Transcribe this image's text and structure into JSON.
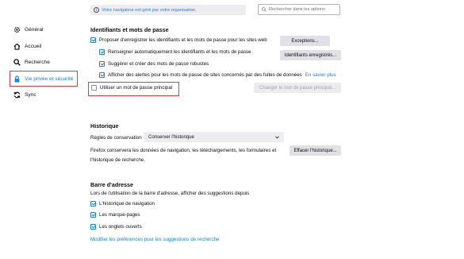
{
  "banner": {
    "text": "Votre navigateur est géré par votre organisation.",
    "icon": "info-icon"
  },
  "search": {
    "placeholder": "Rechercher dans les options",
    "icon": "search-icon"
  },
  "sidebar": {
    "items": [
      {
        "label": "Général",
        "icon": "gear-icon"
      },
      {
        "label": "Accueil",
        "icon": "home-icon"
      },
      {
        "label": "Recherche",
        "icon": "search-icon"
      },
      {
        "label": "Vie privée et sécurité",
        "icon": "lock-icon",
        "selected": true
      },
      {
        "label": "Sync",
        "icon": "sync-icon"
      }
    ]
  },
  "logins": {
    "title": "Identifiants et mots de passe",
    "ask_save": "Proposer d'enregistrer les identifiants et les mots de passe pour les sites web",
    "autofill": "Renseigner automatiquement les identifiants et les mots de passe",
    "suggest": "Suggérer et créer des mots de passe robustes",
    "alerts": "Afficher des alertes pour les mots de passe de sites concernés par des fuites de données",
    "alerts_link": "En savoir plus",
    "primary_password": "Utiliser un mot de passe principal",
    "exceptions_btn": "Exceptions...",
    "saved_logins_btn": "Identifiants enregistrés...",
    "change_primary_btn": "Changer le mot de passe principal..."
  },
  "history": {
    "title": "Historique",
    "rules_label": "Règles de conservation",
    "rules_value": "Conserver l'historique",
    "description_line1": "Firefox conservera les données de navigation, les téléchargements, les formulaires et",
    "description_line2": "l'historique de recherche.",
    "clear_btn": "Effacer l'historique..."
  },
  "addressbar": {
    "title": "Barre d'adresse",
    "description": "Lors de l'utilisation de la barre d'adresse, afficher des suggestions depuis",
    "options": [
      "L'historique de navigation",
      "Les marque-pages",
      "Les onglets ouverts"
    ],
    "link": "Modifier les préférences pour les suggestions de recherche"
  },
  "colors": {
    "accent": "#0a84ff",
    "highlight": "#e33b3b"
  }
}
